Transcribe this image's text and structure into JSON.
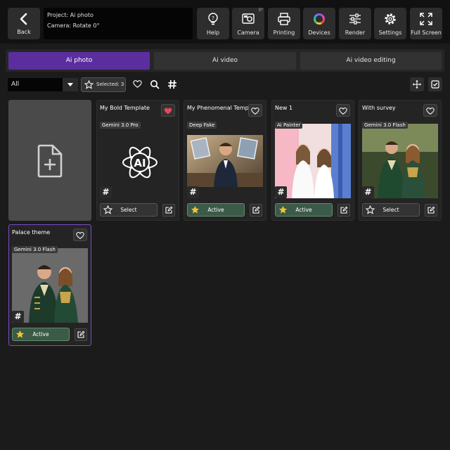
{
  "topbar": {
    "back_label": "Back",
    "project_line": "Project: Ai photo",
    "camera_line": "Camera: Rotate 0°",
    "camera_degree": "0°",
    "tools": [
      {
        "label": "Help",
        "icon": "help-bulb-icon"
      },
      {
        "label": "Camera",
        "icon": "camera-icon"
      },
      {
        "label": "Printing",
        "icon": "printer-icon"
      },
      {
        "label": "Devices",
        "icon": "devices-ring-icon"
      },
      {
        "label": "Render",
        "icon": "sliders-icon"
      },
      {
        "label": "Settings",
        "icon": "gear-icon"
      },
      {
        "label": "Full Screen",
        "icon": "expand-icon"
      }
    ]
  },
  "tabs": [
    {
      "label": "Ai photo",
      "active": true
    },
    {
      "label": "Ai video",
      "active": false
    },
    {
      "label": "Ai video editing",
      "active": false
    }
  ],
  "filters": {
    "category_value": "All",
    "selected_label": "Selected: 3"
  },
  "cards": [
    {
      "title": "My Bold Template",
      "model": "Gemini 3.0 Pro",
      "favorite": true,
      "action": "Select",
      "active": false,
      "thumb": "ai-logo"
    },
    {
      "title": "My Phenomenal Template",
      "model": "Deep Fake",
      "favorite": false,
      "action": "Active",
      "active": true,
      "thumb": "office-man"
    },
    {
      "title": "New 1",
      "model": "Ai Painter",
      "favorite": false,
      "action": "Active",
      "active": true,
      "thumb": "two-women"
    },
    {
      "title": "With survey",
      "model": "Gemini 3.0 Flash",
      "favorite": false,
      "action": "Select",
      "active": false,
      "thumb": "royal-couple"
    },
    {
      "title": "Palace theme",
      "model": "Gemini 3.0 Flash",
      "favorite": false,
      "action": "Active",
      "active": true,
      "thumb": "royal-couple"
    }
  ],
  "colors": {
    "accent_purple": "#5b2ea0",
    "active_green": "#3c5a48",
    "favorite_red": "#e8475a",
    "star_yellow": "#f4c430"
  }
}
